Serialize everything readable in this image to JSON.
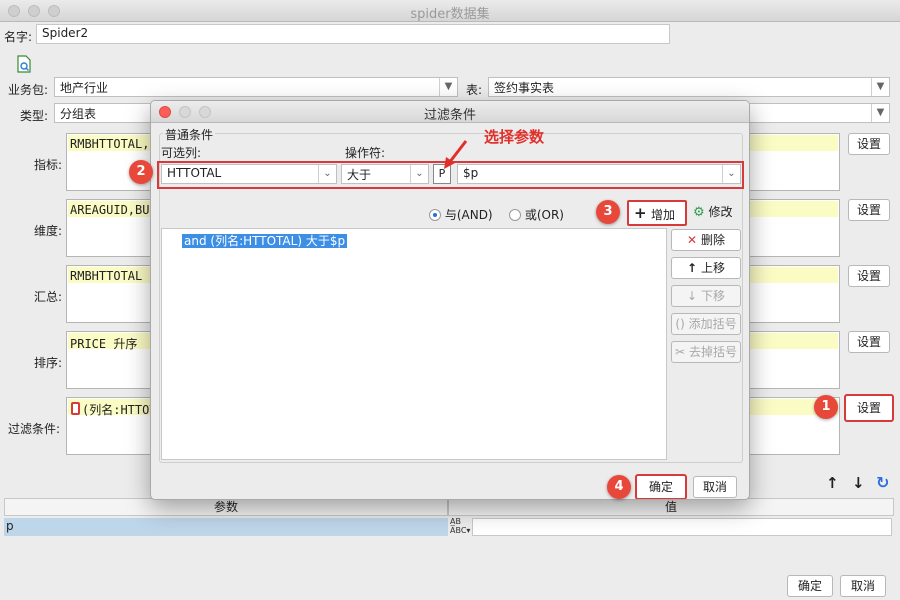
{
  "window": {
    "title": "spider数据集"
  },
  "form": {
    "name_label": "名字:",
    "name_value": "Spider2",
    "package_label": "业务包:",
    "package_value": "地产行业",
    "table_label": "表:",
    "table_value": "签约事实表",
    "type_label": "类型:",
    "type_value": "分组表",
    "metric_label": "指标:",
    "metric_value": "RMBHTTOTAL,",
    "dimension_label": "维度:",
    "dimension_value": "AREAGUID,BUG",
    "summary_label": "汇总:",
    "summary_value": "RMBHTTOTAL",
    "sort_label": "排序:",
    "sort_value": "PRICE 升序",
    "filter_label": "过滤条件:",
    "filter_value": "(列名:HTTOT",
    "settings_button": "设置"
  },
  "params": {
    "col_param": "参数",
    "col_value": "值",
    "row_param": "p",
    "row_value": ""
  },
  "footer": {
    "ok": "确定",
    "cancel": "取消"
  },
  "dialog": {
    "title": "过滤条件",
    "group_title": "普通条件",
    "column_label": "可选列:",
    "operator_label": "操作符:",
    "column_value": "HTTOTAL",
    "operator_value": "大于",
    "param_icon_text": "P",
    "value_text": "$p",
    "and_label": "与(AND)",
    "or_label": "或(OR)",
    "add_button": "增加",
    "edit_button": "修改",
    "delete_button": "删除",
    "move_up_button": "上移",
    "move_down_button": "下移",
    "add_bracket_button": "添加括号",
    "remove_bracket_button": "去掉括号",
    "condition_item": "and (列名:HTTOTAL) 大于$p",
    "ok": "确定",
    "cancel": "取消"
  },
  "annotations": {
    "callout_text": "选择参数",
    "badge1": "1",
    "badge2": "2",
    "badge3": "3",
    "badge4": "4",
    "accent_color": "#d63a3a"
  }
}
